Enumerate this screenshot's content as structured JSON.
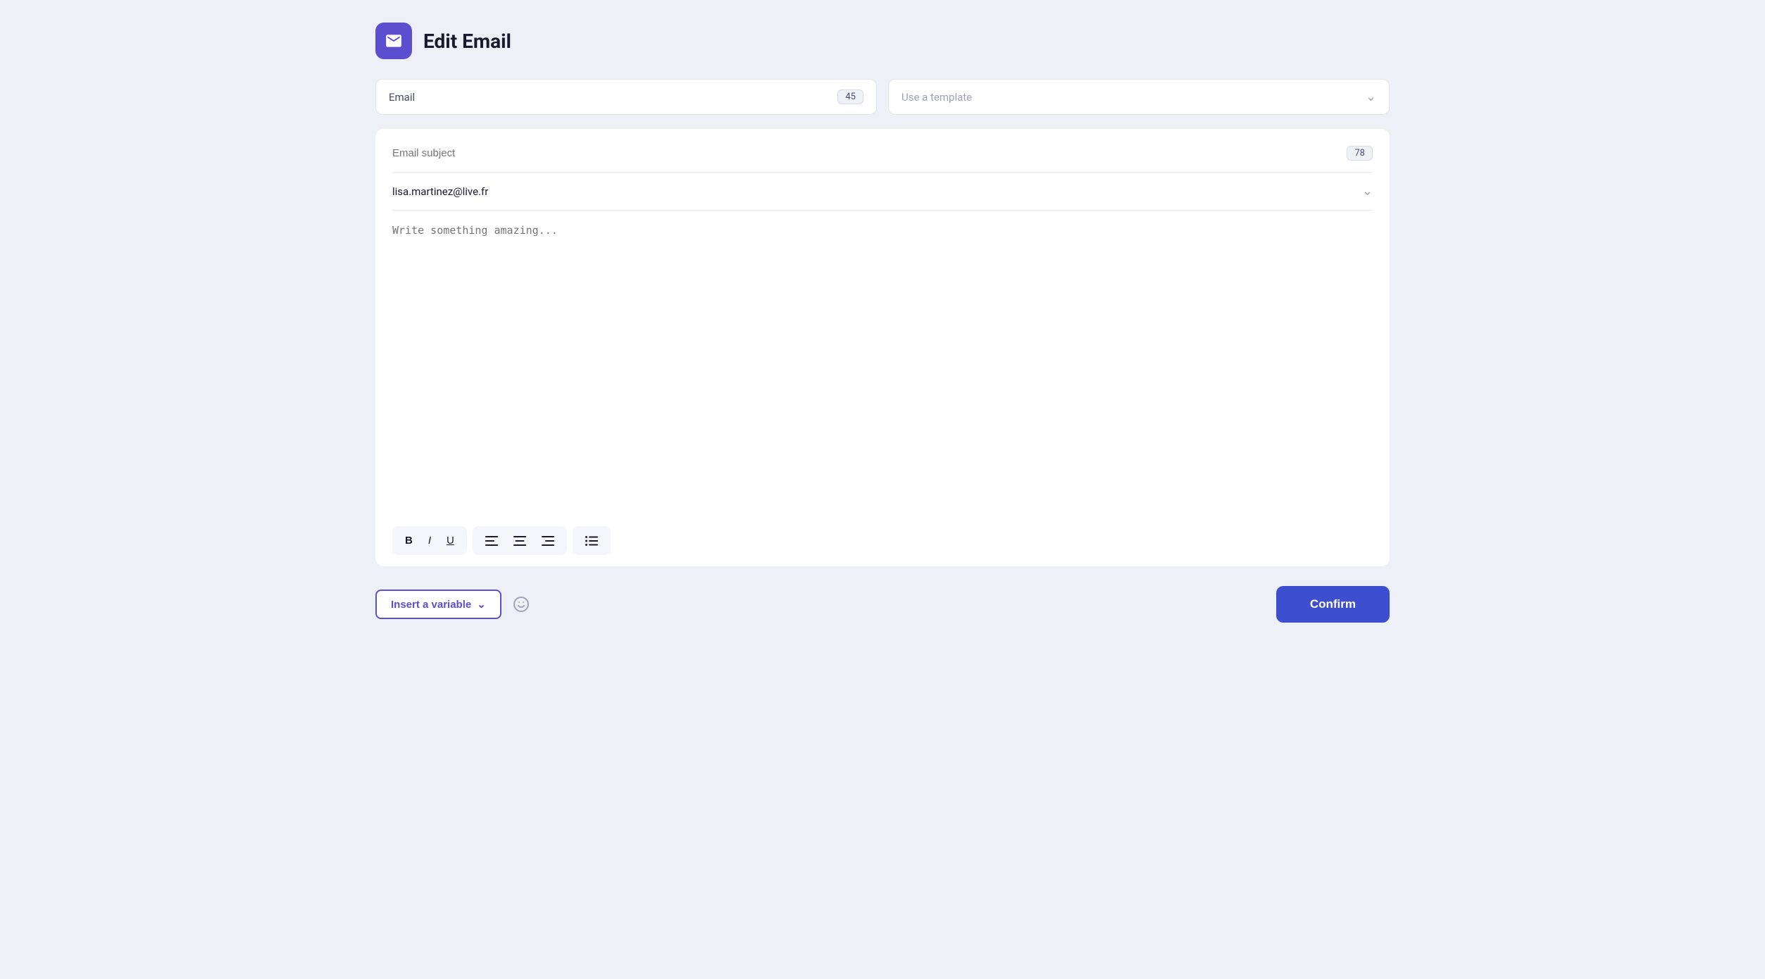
{
  "header": {
    "title": "Edit Email",
    "icon": "email-icon"
  },
  "top_row": {
    "email_label": "Email",
    "email_count": "45",
    "template_placeholder": "Use a template"
  },
  "editor": {
    "subject_placeholder": "Email subject",
    "subject_count": "78",
    "recipient_email": "lisa.martinez@live.fr",
    "body_placeholder": "Write something amazing..."
  },
  "toolbar": {
    "bold_label": "B",
    "italic_label": "I",
    "underline_label": "U",
    "align_left_label": "≡",
    "align_center_label": "≡",
    "align_right_label": "≡",
    "list_label": "☰"
  },
  "bottom_bar": {
    "insert_variable_label": "Insert a variable",
    "confirm_label": "Confirm"
  },
  "colors": {
    "accent": "#5b4fcf",
    "confirm_bg": "#3d4ecf"
  }
}
